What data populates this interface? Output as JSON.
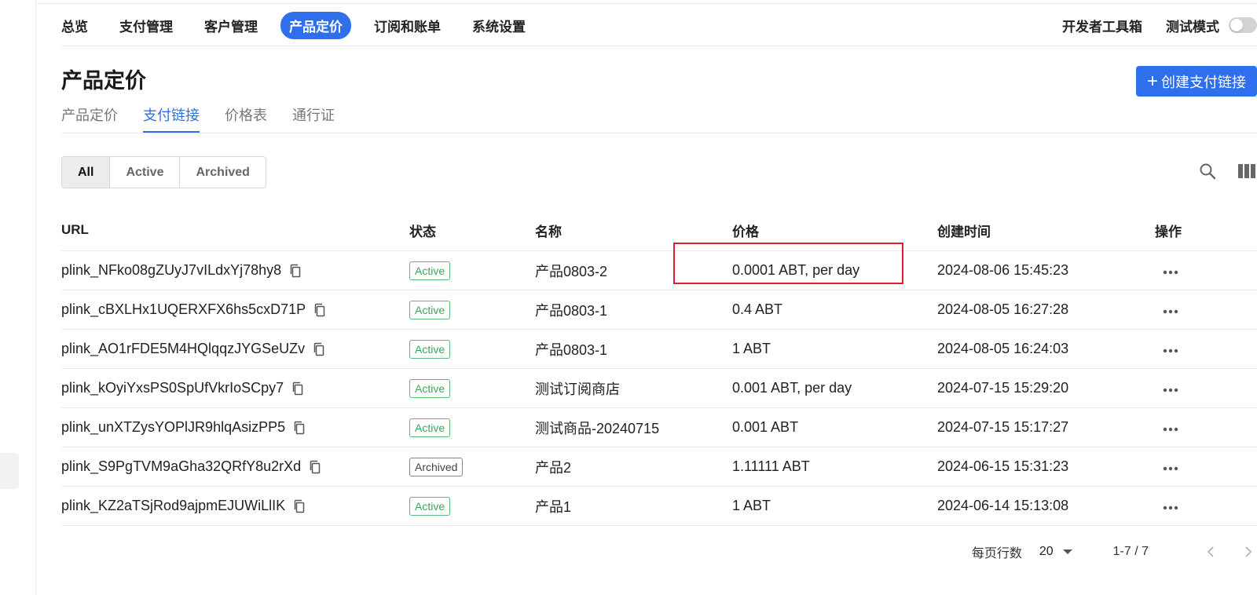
{
  "nav": {
    "items": [
      {
        "label": "总览",
        "active": false
      },
      {
        "label": "支付管理",
        "active": false
      },
      {
        "label": "客户管理",
        "active": false
      },
      {
        "label": "产品定价",
        "active": true
      },
      {
        "label": "订阅和账单",
        "active": false
      },
      {
        "label": "系统设置",
        "active": false
      }
    ],
    "dev_tools": "开发者工具箱",
    "test_mode": "测试模式",
    "test_mode_on": false
  },
  "header": {
    "title": "产品定价",
    "create_button": "创建支付链接"
  },
  "subtabs": [
    {
      "label": "产品定价",
      "active": false
    },
    {
      "label": "支付链接",
      "active": true
    },
    {
      "label": "价格表",
      "active": false
    },
    {
      "label": "通行证",
      "active": false
    }
  ],
  "filters": [
    {
      "label": "All",
      "active": true
    },
    {
      "label": "Active",
      "active": false
    },
    {
      "label": "Archived",
      "active": false
    }
  ],
  "table": {
    "columns": [
      "URL",
      "状态",
      "名称",
      "价格",
      "创建时间",
      "操作"
    ],
    "rows": [
      {
        "url": "plink_NFko08gZUyJ7vILdxYj78hy8",
        "status": "Active",
        "name": "产品0803-2",
        "price": "0.0001 ABT, per day",
        "created": "2024-08-06 15:45:23"
      },
      {
        "url": "plink_cBXLHx1UQERXFX6hs5cxD71P",
        "status": "Active",
        "name": "产品0803-1",
        "price": "0.4 ABT",
        "created": "2024-08-05 16:27:28"
      },
      {
        "url": "plink_AO1rFDE5M4HQlqqzJYGSeUZv",
        "status": "Active",
        "name": "产品0803-1",
        "price": "1 ABT",
        "created": "2024-08-05 16:24:03"
      },
      {
        "url": "plink_kOyiYxsPS0SpUfVkrIoSCpy7",
        "status": "Active",
        "name": "测试订阅商店",
        "price": "0.001 ABT, per day",
        "created": "2024-07-15 15:29:20"
      },
      {
        "url": "plink_unXTZysYOPlJR9hlqAsizPP5",
        "status": "Active",
        "name": "测试商品-20240715",
        "price": "0.001 ABT",
        "created": "2024-07-15 15:17:27"
      },
      {
        "url": "plink_S9PgTVM9aGha32QRfY8u2rXd",
        "status": "Archived",
        "name": "产品2",
        "price": "1.11111 ABT",
        "created": "2024-06-15 15:31:23"
      },
      {
        "url": "plink_KZ2aTSjRod9ajpmEJUWiLlIK",
        "status": "Active",
        "name": "产品1",
        "price": "1 ABT",
        "created": "2024-06-14 15:13:08"
      }
    ]
  },
  "pagination": {
    "rows_per_page_label": "每页行数",
    "rows_per_page": "20",
    "range": "1-7 / 7"
  },
  "colors": {
    "accent": "#2f6fec",
    "active_badge": "#3ba55c",
    "highlight": "#e11d2a"
  }
}
